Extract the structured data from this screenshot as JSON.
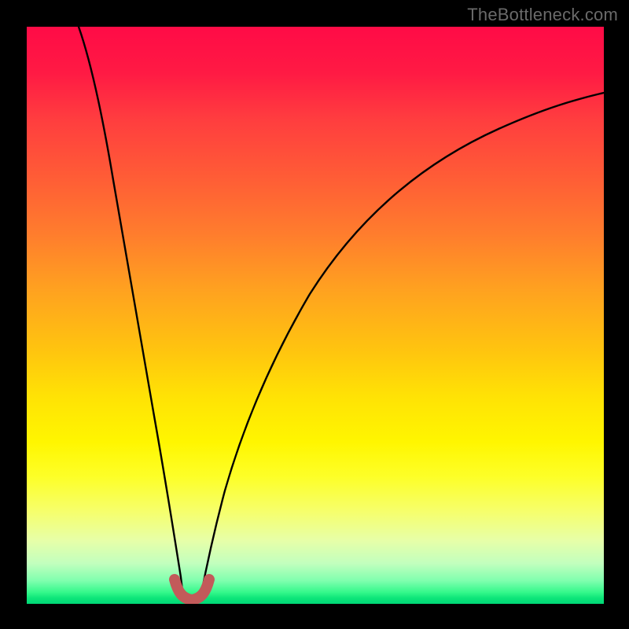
{
  "watermark": {
    "text": "TheBottleneck.com"
  },
  "chart_data": {
    "type": "line",
    "title": "",
    "xlabel": "",
    "ylabel": "",
    "xlim": [
      0,
      100
    ],
    "ylim": [
      0,
      100
    ],
    "grid": false,
    "legend": false,
    "background_gradient": {
      "orientation": "vertical",
      "stops": [
        {
          "pos": 0.0,
          "color": "#ff0b46"
        },
        {
          "pos": 0.16,
          "color": "#ff3d3f"
        },
        {
          "pos": 0.36,
          "color": "#ff7d2d"
        },
        {
          "pos": 0.56,
          "color": "#ffc40f"
        },
        {
          "pos": 0.72,
          "color": "#fff600"
        },
        {
          "pos": 0.89,
          "color": "#e7ffa8"
        },
        {
          "pos": 0.96,
          "color": "#7fffae"
        },
        {
          "pos": 1.0,
          "color": "#00d877"
        }
      ]
    },
    "series": [
      {
        "name": "left-branch",
        "color": "#000000",
        "x": [
          9.0,
          11.0,
          13.0,
          15.0,
          17.5,
          20.0,
          22.0,
          24.0,
          25.5,
          27.0
        ],
        "y": [
          100,
          87,
          73,
          59,
          44,
          29,
          18,
          8,
          3,
          0.6
        ]
      },
      {
        "name": "right-branch",
        "color": "#000000",
        "x": [
          30.0,
          32.0,
          34.0,
          37.0,
          41.0,
          46.0,
          52.0,
          59.0,
          67.0,
          76.0,
          86.0,
          100.0
        ],
        "y": [
          0.6,
          5,
          11,
          19,
          29,
          40,
          50,
          59,
          67,
          74,
          80,
          86
        ]
      },
      {
        "name": "valley-marker",
        "color": "#c25a5a",
        "stroke_width": 14,
        "linecap": "round",
        "x": [
          25.6,
          26.6,
          27.6,
          28.6,
          29.6,
          30.6,
          31.6
        ],
        "y": [
          3.7,
          1.6,
          0.7,
          0.5,
          0.7,
          1.6,
          3.7
        ]
      }
    ],
    "annotations": []
  }
}
